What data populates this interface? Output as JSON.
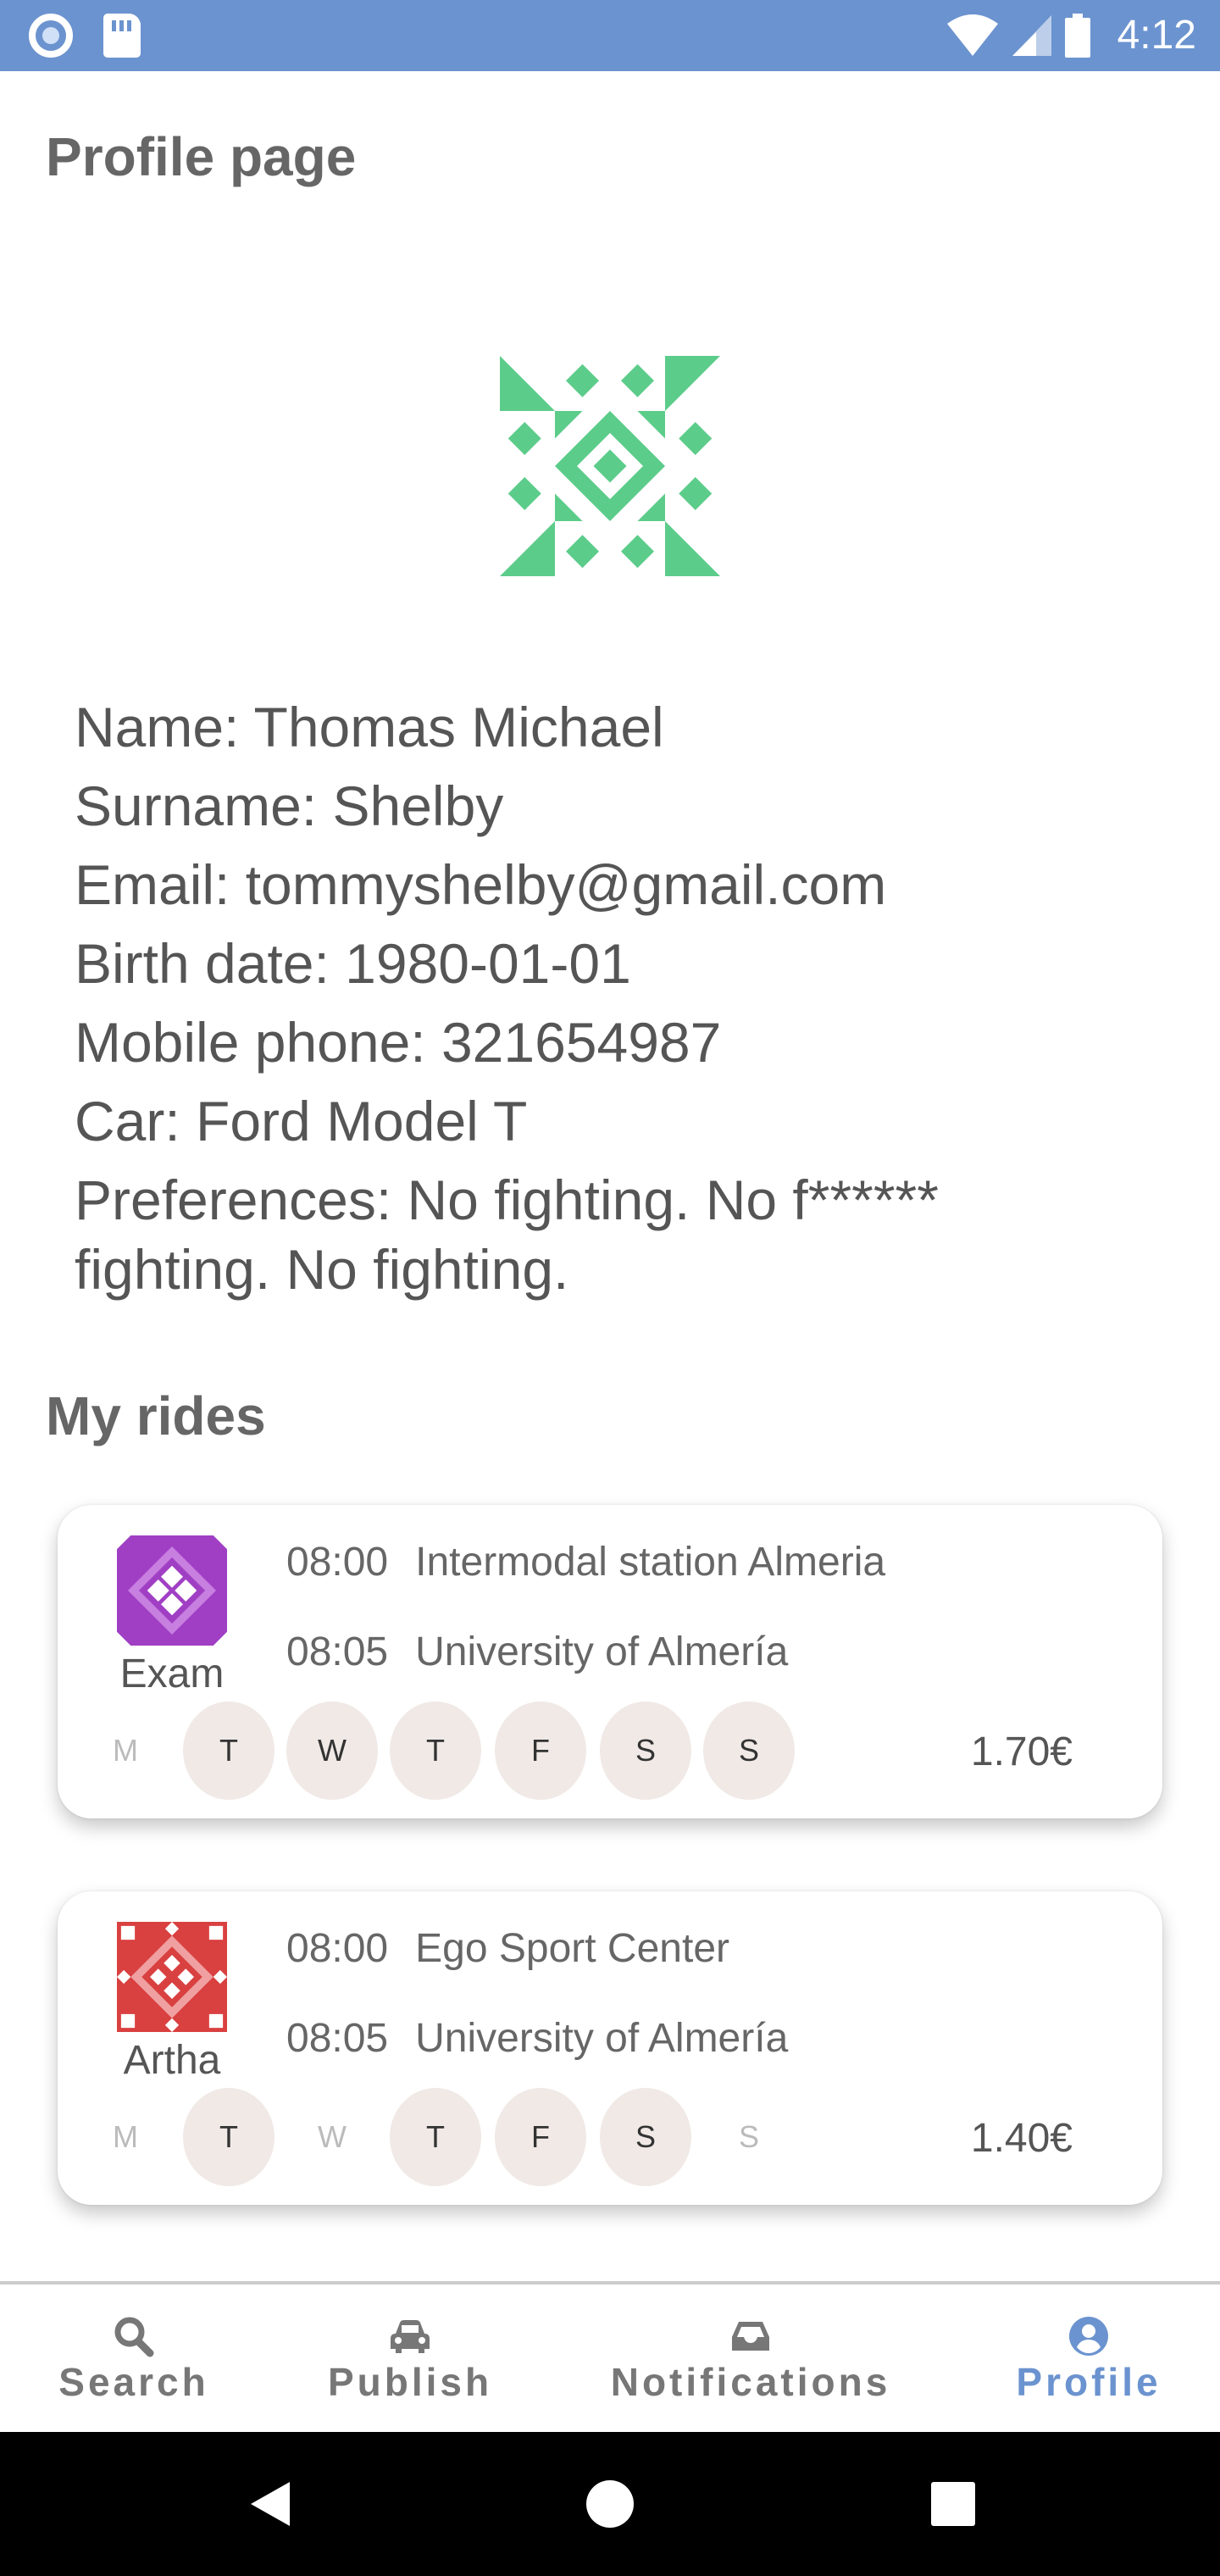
{
  "status_bar": {
    "time": "4:12"
  },
  "profile": {
    "title": "Profile page",
    "name": "Name: Thomas Michael",
    "surname": "Surname: Shelby",
    "email": "Email: tommyshelby@gmail.com",
    "birth_date": "Birth date: 1980-01-01",
    "mobile_phone": "Mobile phone: 321654987",
    "car": "Car: Ford Model T",
    "preferences_line1": "Preferences: No fighting. No f******",
    "preferences_line2": "fighting. No fighting.",
    "avatar_color": "#5ccc8a"
  },
  "rides": {
    "title": "My rides",
    "items": [
      {
        "driver": "Exam",
        "avatar_color": "#a03fc4",
        "depart_time": "08:00",
        "origin": "Intermodal station Almeria",
        "arrive_time": "08:05",
        "destination": "University of Almería",
        "price": "1.70€",
        "days": [
          {
            "label": "M",
            "active": false
          },
          {
            "label": "T",
            "active": true
          },
          {
            "label": "W",
            "active": true
          },
          {
            "label": "T",
            "active": true
          },
          {
            "label": "F",
            "active": true
          },
          {
            "label": "S",
            "active": true
          },
          {
            "label": "S",
            "active": true
          }
        ]
      },
      {
        "driver": "Artha",
        "avatar_color": "#d94040",
        "depart_time": "08:00",
        "origin": "Ego Sport Center",
        "arrive_time": "08:05",
        "destination": "University of Almería",
        "price": "1.40€",
        "days": [
          {
            "label": "M",
            "active": false
          },
          {
            "label": "T",
            "active": true
          },
          {
            "label": "W",
            "active": false
          },
          {
            "label": "T",
            "active": true
          },
          {
            "label": "F",
            "active": true
          },
          {
            "label": "S",
            "active": true
          },
          {
            "label": "S",
            "active": false
          }
        ]
      }
    ]
  },
  "nav": {
    "search": "Search",
    "publish": "Publish",
    "notifications": "Notifications",
    "profile": "Profile",
    "active_color": "#6b93cf"
  }
}
